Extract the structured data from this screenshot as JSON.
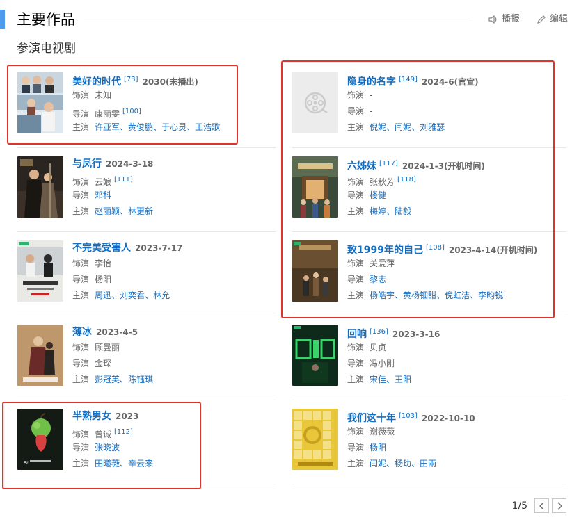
{
  "header": {
    "title": "主要作品",
    "broadcast_label": "播报",
    "edit_label": "编辑"
  },
  "section_title": "参演电视剧",
  "labels": {
    "role": "饰演",
    "director": "导演",
    "stars": "主演"
  },
  "left": [
    {
      "name": "美好的时代",
      "date": "2030",
      "ref": "[73]",
      "extra": "(未播出)",
      "role": "未知",
      "role_ref": "",
      "director": "康丽雯",
      "director_ref": "[100]",
      "director_link": false,
      "stars": [
        "许亚军",
        "黄俊鹏",
        "于心灵",
        "王浩歌"
      ]
    },
    {
      "name": "与凤行",
      "date": "2024-3-18",
      "ref": "",
      "extra": "",
      "role": "云娘",
      "role_ref": "[111]",
      "director": "邓科",
      "director_ref": "",
      "director_link": true,
      "stars": [
        "赵丽颖",
        "林更新"
      ]
    },
    {
      "name": "不完美受害人",
      "date": "2023-7-17",
      "ref": "",
      "extra": "",
      "role": "李怡",
      "role_ref": "",
      "director": "杨阳",
      "director_ref": "",
      "director_link": false,
      "stars": [
        "周迅",
        "刘奕君",
        "林允"
      ]
    },
    {
      "name": "薄冰",
      "date": "2023-4-5",
      "ref": "",
      "extra": "",
      "role": "顾曼丽",
      "role_ref": "",
      "director": "金琛",
      "director_ref": "",
      "director_link": false,
      "stars": [
        "彭冠英",
        "陈钰琪"
      ]
    },
    {
      "name": "半熟男女",
      "date": "2023",
      "ref": "",
      "extra": "",
      "role": "曾诚",
      "role_ref": "[112]",
      "director": "张晓波",
      "director_ref": "",
      "director_link": true,
      "stars": [
        "田曦薇",
        "辛云来"
      ]
    }
  ],
  "right": [
    {
      "name": "隐身的名字",
      "date": "2024-6(官宣)",
      "ref": "[149]",
      "extra": "",
      "role": "-",
      "role_ref": "",
      "director": "-",
      "director_ref": "",
      "director_link": false,
      "stars": [
        "倪妮",
        "闫妮",
        "刘雅瑟"
      ]
    },
    {
      "name": "六姊妹",
      "date": "2024-1-3(开机时间)",
      "ref": "[117]",
      "extra": "",
      "role": "张秋芳",
      "role_ref": "[118]",
      "director": "楼健",
      "director_ref": "",
      "director_link": true,
      "stars": [
        "梅婷",
        "陆毅"
      ]
    },
    {
      "name": "致1999年的自己",
      "date": "2023-4-14(开机时间)",
      "ref": "[108]",
      "extra": "",
      "role": "关爱萍",
      "role_ref": "",
      "director": "黎志",
      "director_ref": "",
      "director_link": true,
      "stars": [
        "杨皓宇",
        "黄杨钿甜",
        "倪虹洁",
        "李昀锐"
      ]
    },
    {
      "name": "回响",
      "date": "2023-3-16",
      "ref": "[136]",
      "extra": "",
      "role": "贝贞",
      "role_ref": "",
      "director": "冯小刚",
      "director_ref": "",
      "director_link": false,
      "stars": [
        "宋佳",
        "王阳"
      ]
    },
    {
      "name": "我们这十年",
      "date": "2022-10-10",
      "ref": "[103]",
      "extra": "",
      "role": "谢薇薇",
      "role_ref": "",
      "director": "杨阳",
      "director_ref": "",
      "director_link": true,
      "stars": [
        "闫妮",
        "杨玏",
        "田雨"
      ]
    }
  ],
  "pager": {
    "text": "1/5"
  },
  "colors": {
    "accent": "#4f9cee",
    "link": "#136ec2",
    "highlight": "#e0332b"
  }
}
